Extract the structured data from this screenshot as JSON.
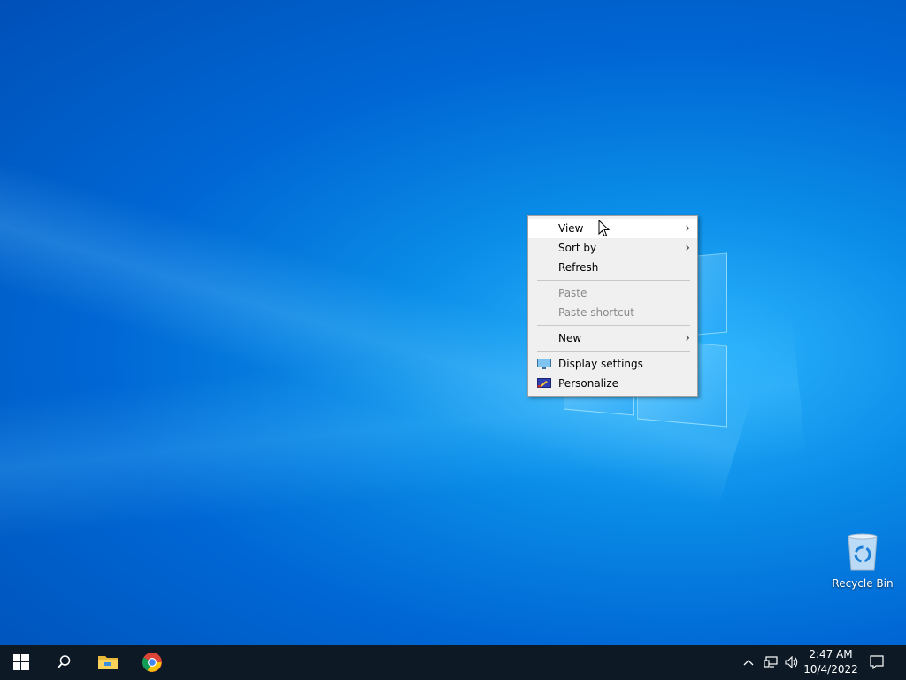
{
  "desktop": {
    "icons": [
      {
        "label": "Recycle Bin",
        "icon": "recycle-bin-icon"
      }
    ]
  },
  "context_menu": {
    "items": [
      {
        "label": "View",
        "submenu": true,
        "enabled": true,
        "highlighted": true
      },
      {
        "label": "Sort by",
        "submenu": true,
        "enabled": true
      },
      {
        "label": "Refresh",
        "enabled": true
      },
      {
        "separator": true
      },
      {
        "label": "Paste",
        "enabled": false
      },
      {
        "label": "Paste shortcut",
        "enabled": false
      },
      {
        "separator": true
      },
      {
        "label": "New",
        "submenu": true,
        "enabled": true
      },
      {
        "separator": true
      },
      {
        "label": "Display settings",
        "icon": "display-settings-icon",
        "enabled": true
      },
      {
        "label": "Personalize",
        "icon": "personalize-icon",
        "enabled": true
      }
    ],
    "submenu_arrow": ">"
  },
  "taskbar": {
    "buttons": [
      {
        "name": "start",
        "icon": "windows-logo-icon"
      },
      {
        "name": "search",
        "icon": "search-icon"
      },
      {
        "name": "file-explorer",
        "icon": "folder-icon"
      },
      {
        "name": "chrome",
        "icon": "chrome-icon"
      }
    ],
    "tray": {
      "chevron_icon": "chevron-up-icon",
      "network_icon": "network-icon",
      "volume_icon": "volume-icon",
      "time": "2:47 AM",
      "date": "10/4/2022",
      "notification_icon": "action-center-icon"
    }
  },
  "colors": {
    "desktop_blue": "#0067d4",
    "taskbar": "#0d1a26",
    "menu_bg": "#f0f0f0",
    "menu_hover": "#ffffff",
    "disabled_text": "#8a8a8a"
  }
}
